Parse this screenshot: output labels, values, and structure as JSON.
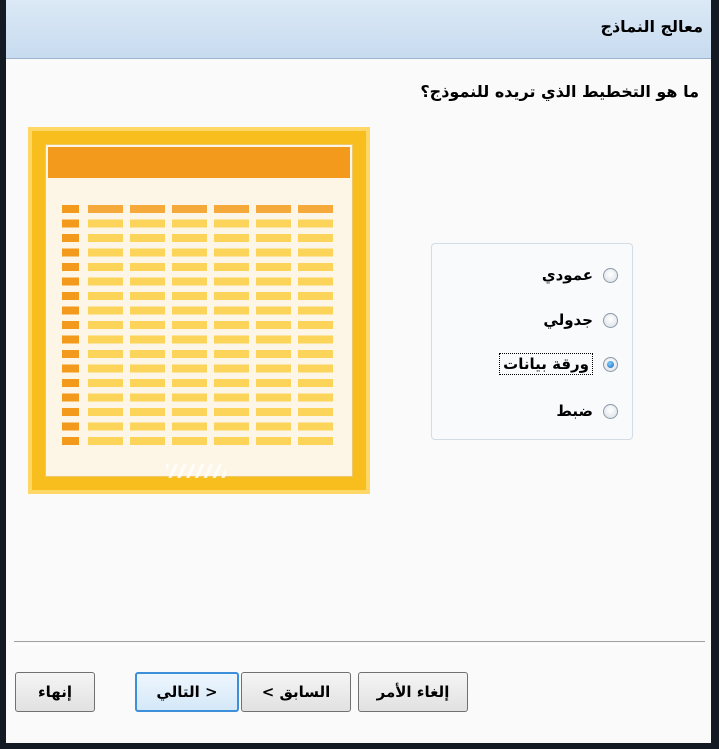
{
  "window": {
    "title": "معالج النماذج"
  },
  "wizard": {
    "question": "ما هو التخطيط الذي تريده للنموذج؟",
    "layout_options": [
      {
        "label": "عمودي",
        "selected": false
      },
      {
        "label": "جدولي",
        "selected": false
      },
      {
        "label": "ورقة بيانات",
        "selected": true
      },
      {
        "label": "ضبط",
        "selected": false
      }
    ],
    "preview_icon": "datasheet-layout-preview"
  },
  "buttons": {
    "cancel_label": "إلغاء الأمر",
    "back_label": "< السابق",
    "next_label": "التالي >",
    "finish_label": "إنهاء"
  },
  "colors": {
    "preview_frame": "#f7be1d",
    "preview_header": "#f39a1c",
    "preview_cells": "#fcd45a",
    "radio_selected": "#1b64b4",
    "default_button_border": "#3c8fd8"
  }
}
